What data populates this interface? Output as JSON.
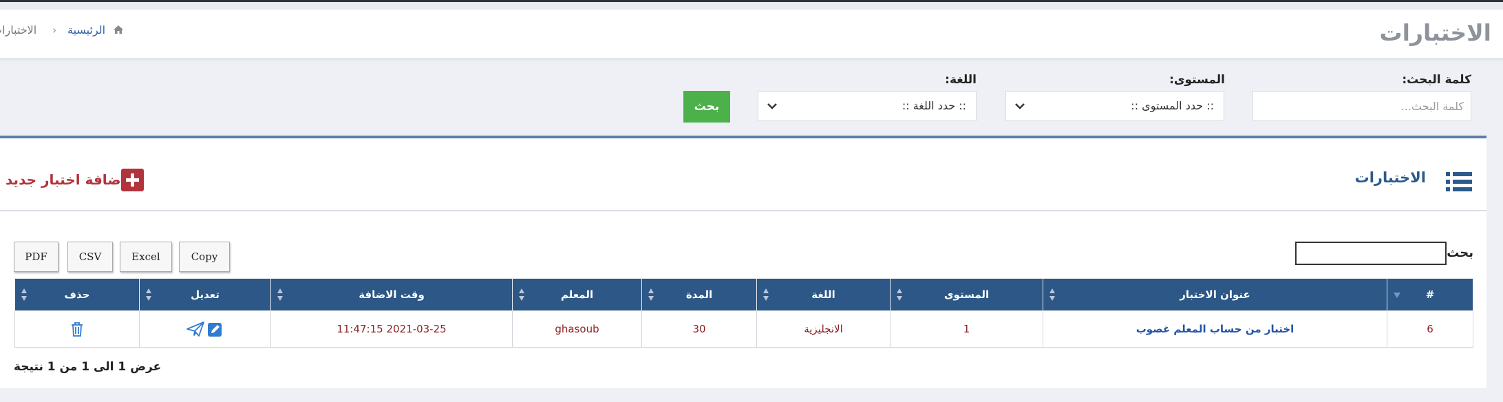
{
  "header": {
    "page_title": "الاختبارات",
    "breadcrumb": {
      "home": "الرئيسية",
      "current": "الاختبارات"
    }
  },
  "filters": {
    "keyword_label": "كلمة البحث:",
    "keyword_placeholder": "كلمة البحث...",
    "level_label": "المستوى:",
    "level_value": ":: حدد المستوى ::",
    "language_label": "اللغة:",
    "language_value": ":: حدد اللغة ::",
    "search_button": "بحث"
  },
  "panel": {
    "title": "الاختبارات",
    "add_button": "اضافة اختبار جديد"
  },
  "export_buttons": [
    "PDF",
    "CSV",
    "Excel",
    "Copy"
  ],
  "table_search_label": "بحث:",
  "table": {
    "columns": [
      "#",
      "عنوان الاختبار",
      "المستوى",
      "اللغة",
      "المدة",
      "المعلم",
      "وقت الاضافة",
      "تعديل",
      "حذف"
    ],
    "rows": [
      {
        "id": "6",
        "title": "اختبار من حساب المعلم غصوب",
        "level": "1",
        "language": "الانجليزية",
        "duration": "30",
        "teacher": "ghasoub",
        "added_at": "2021-03-25 11:47:15"
      }
    ]
  },
  "table_footer": "عرض 1 الى 1 من 1 نتيجة",
  "colors": {
    "primary": "#2c5786",
    "success": "#4cb04b",
    "danger": "#b1333b",
    "accent": "#5b7fa8"
  }
}
